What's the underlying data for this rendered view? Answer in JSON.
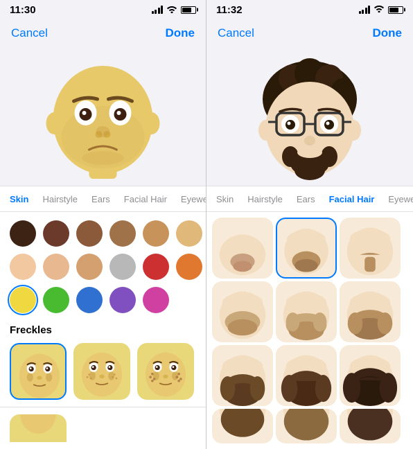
{
  "left": {
    "status": {
      "time": "11:30"
    },
    "nav": {
      "cancel": "Cancel",
      "done": "Done"
    },
    "tabs": [
      {
        "id": "skin",
        "label": "Skin",
        "active": true
      },
      {
        "id": "hairstyle",
        "label": "Hairstyle",
        "active": false
      },
      {
        "id": "ears",
        "label": "Ears",
        "active": false
      },
      {
        "id": "facial-hair",
        "label": "Facial Hair",
        "active": false
      },
      {
        "id": "eyewear",
        "label": "Eyewear",
        "active": false
      }
    ],
    "colors": {
      "row1": [
        "#3d2314",
        "#6b3a2a",
        "#8b5a3a",
        "#a0724a",
        "#c8935a",
        "#e0b87a"
      ],
      "row2": [
        "#f2c8a0",
        "#e8b890",
        "#d4a070",
        "#b8b8b8",
        "#cc3030",
        "#e07830"
      ],
      "row3": [
        "#f0d840",
        "#48bb30",
        "#3070d0",
        "#8050c0",
        "#d040a0"
      ]
    },
    "freckles_label": "Freckles"
  },
  "right": {
    "status": {
      "time": "11:32"
    },
    "nav": {
      "cancel": "Cancel",
      "done": "Done"
    },
    "tabs": [
      {
        "id": "skin",
        "label": "Skin",
        "active": false
      },
      {
        "id": "hairstyle",
        "label": "Hairstyle",
        "active": false
      },
      {
        "id": "ears",
        "label": "Ears",
        "active": false
      },
      {
        "id": "facial-hair",
        "label": "Facial Hair",
        "active": true
      },
      {
        "id": "eyewear",
        "label": "Eyewear",
        "active": false
      }
    ]
  }
}
